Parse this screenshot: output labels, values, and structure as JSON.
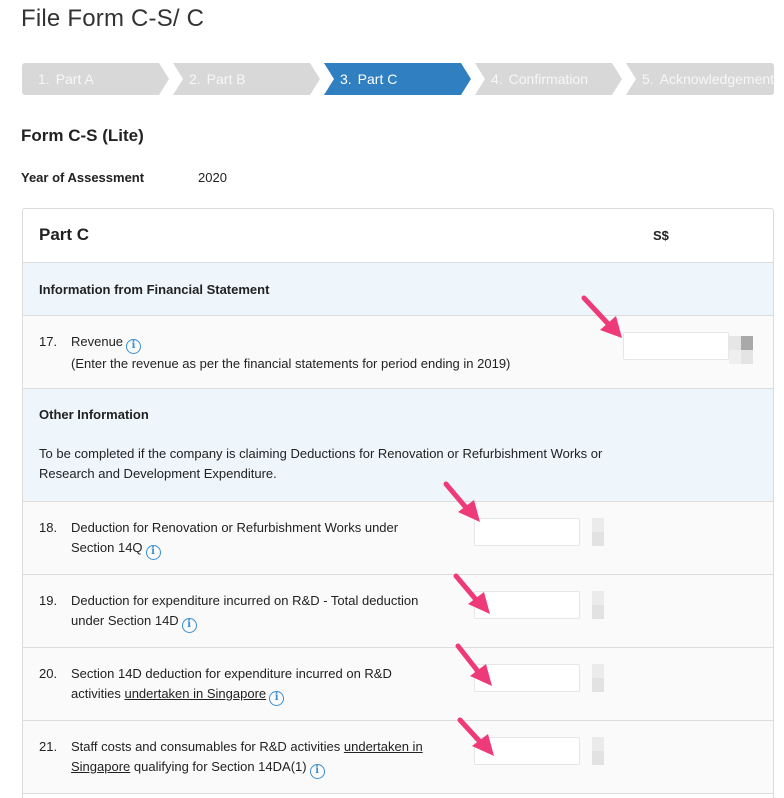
{
  "page": {
    "title": "File Form C-S/ C"
  },
  "stepper": {
    "steps": [
      {
        "num": "1.",
        "label": "Part A"
      },
      {
        "num": "2.",
        "label": "Part B"
      },
      {
        "num": "3.",
        "label": "Part C"
      },
      {
        "num": "4.",
        "label": "Confirmation"
      },
      {
        "num": "5.",
        "label": "Acknowledgement"
      }
    ],
    "active_index": 2
  },
  "form": {
    "title": "Form C-S (Lite)",
    "year_label": "Year of Assessment",
    "year_value": "2020"
  },
  "card": {
    "title": "Part C",
    "currency": "S$",
    "section1": {
      "heading": "Information from Financial Statement"
    },
    "item17": {
      "num": "17.",
      "label": "Revenue",
      "note": "(Enter the revenue as per the financial statements for period ending in 2019)"
    },
    "section2": {
      "heading": "Other Information",
      "desc": "To be completed if the company is claiming Deductions for Renovation or Refurbishment Works or Research and Development Expenditure."
    },
    "item18": {
      "num": "18.",
      "line1": "Deduction for Renovation or Refurbishment Works under",
      "line2": "Section 14Q"
    },
    "item19": {
      "num": "19.",
      "line1": "Deduction for expenditure incurred on R&D - Total deduction",
      "line2": "under Section 14D"
    },
    "item20": {
      "num": "20.",
      "line1": "Section 14D deduction for expenditure incurred on R&D",
      "line2a": "activities ",
      "line2u": "undertaken in Singapore"
    },
    "item21": {
      "num": "21.",
      "line1a": "Staff costs and consumables for R&D activities ",
      "line1u": "undertaken in",
      "line2u": "Singapore",
      "line2b": " qualifying for Section 14DA(1)"
    }
  },
  "colors": {
    "accent": "#2f7fc1",
    "step_inactive": "#d8d8d8",
    "arrow": "#ee3a78",
    "section_bg": "#eef5fb",
    "info_icon": "#3a8ed1"
  },
  "icons": {
    "info": "info-icon",
    "arrow": "pointer-arrow-icon"
  }
}
